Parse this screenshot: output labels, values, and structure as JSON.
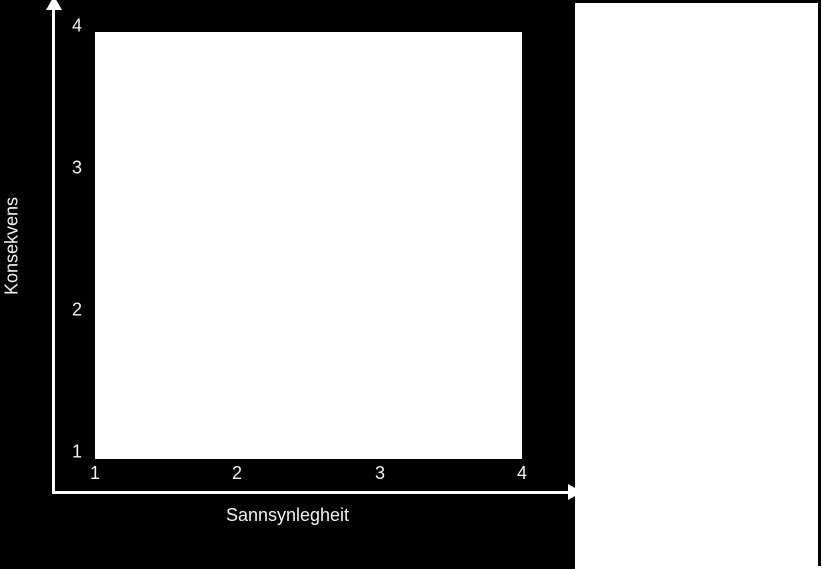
{
  "chart_data": {
    "type": "scatter",
    "series": [],
    "x": [],
    "y": [],
    "title": "",
    "xlabel": "Sannsynlegheit",
    "ylabel": "Konsekvens",
    "xlim": [
      1,
      4
    ],
    "ylim": [
      1,
      4
    ],
    "x_ticks": [
      1,
      2,
      3,
      4
    ],
    "y_ticks": [
      1,
      2,
      3,
      4
    ]
  }
}
